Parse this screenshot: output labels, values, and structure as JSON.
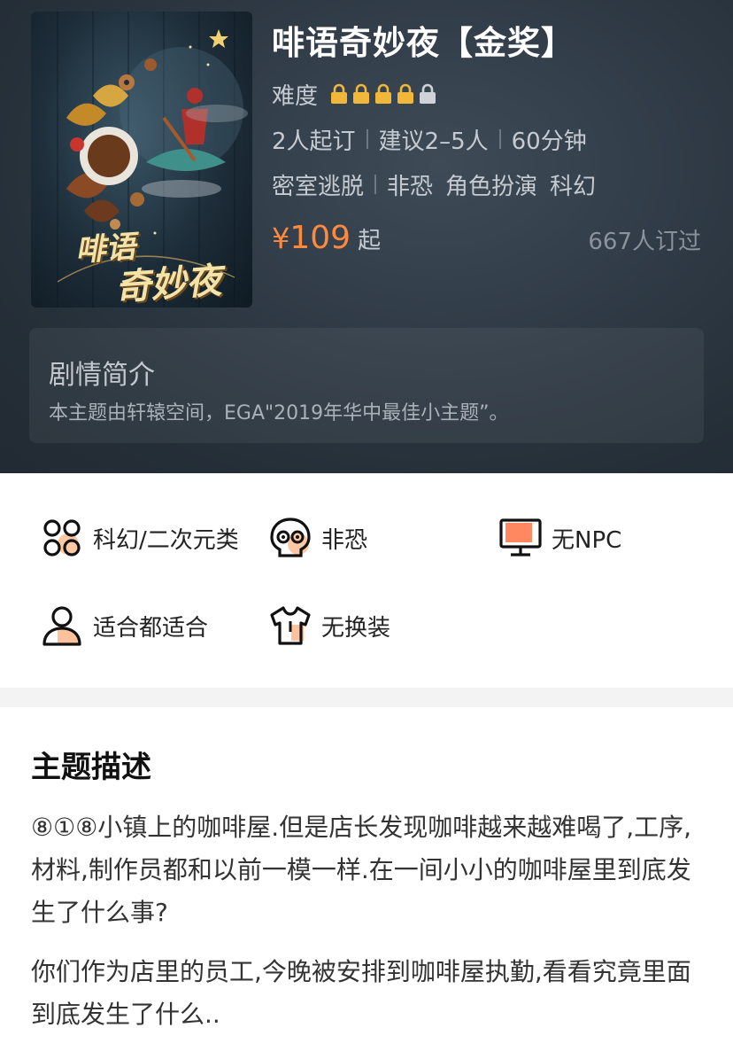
{
  "product": {
    "title": "啡语奇妙夜【金奖】",
    "poster_title_line1": "啡语",
    "poster_title_line2": "奇妙夜",
    "difficulty_label": "难度",
    "difficulty_level": 4,
    "difficulty_max": 5,
    "min_order": "2人起订",
    "suggested_players": "建议2–5人",
    "duration": "60分钟",
    "tags": [
      "密室逃脱",
      "非恐",
      "角色扮演",
      "科幻"
    ],
    "price_currency": "¥",
    "price_value": "109",
    "price_suffix": "起",
    "booked_count": "667人订过"
  },
  "story": {
    "title": "剧情简介",
    "text": "本主题由轩辕空间，EGA\"2019年华中最佳小主题”。"
  },
  "features": [
    {
      "icon": "genre-icon",
      "label": "科幻/二次元类"
    },
    {
      "icon": "scare-level-icon",
      "label": "非恐"
    },
    {
      "icon": "npc-icon",
      "label": "无NPC"
    },
    {
      "icon": "audience-icon",
      "label": "适合都适合"
    },
    {
      "icon": "costume-icon",
      "label": "无换装"
    }
  ],
  "description": {
    "title": "主题描述",
    "paragraphs": [
      "⑧①⑧小镇上的咖啡屋.但是店长发现咖啡越来越难喝了,工序,材料,制作员都和以前一模一样.在一间小小的咖啡屋里到底发生了什么事?",
      "你们作为店里的员工,今晚被安排到咖啡屋执勤,看看究竟里面到底发生了什么.."
    ]
  },
  "colors": {
    "accent_orange": "#ff8a3d",
    "lock_gold": "#f0b73a",
    "lock_inactive": "#cfd3d8",
    "header_bg": "#2e3944"
  }
}
